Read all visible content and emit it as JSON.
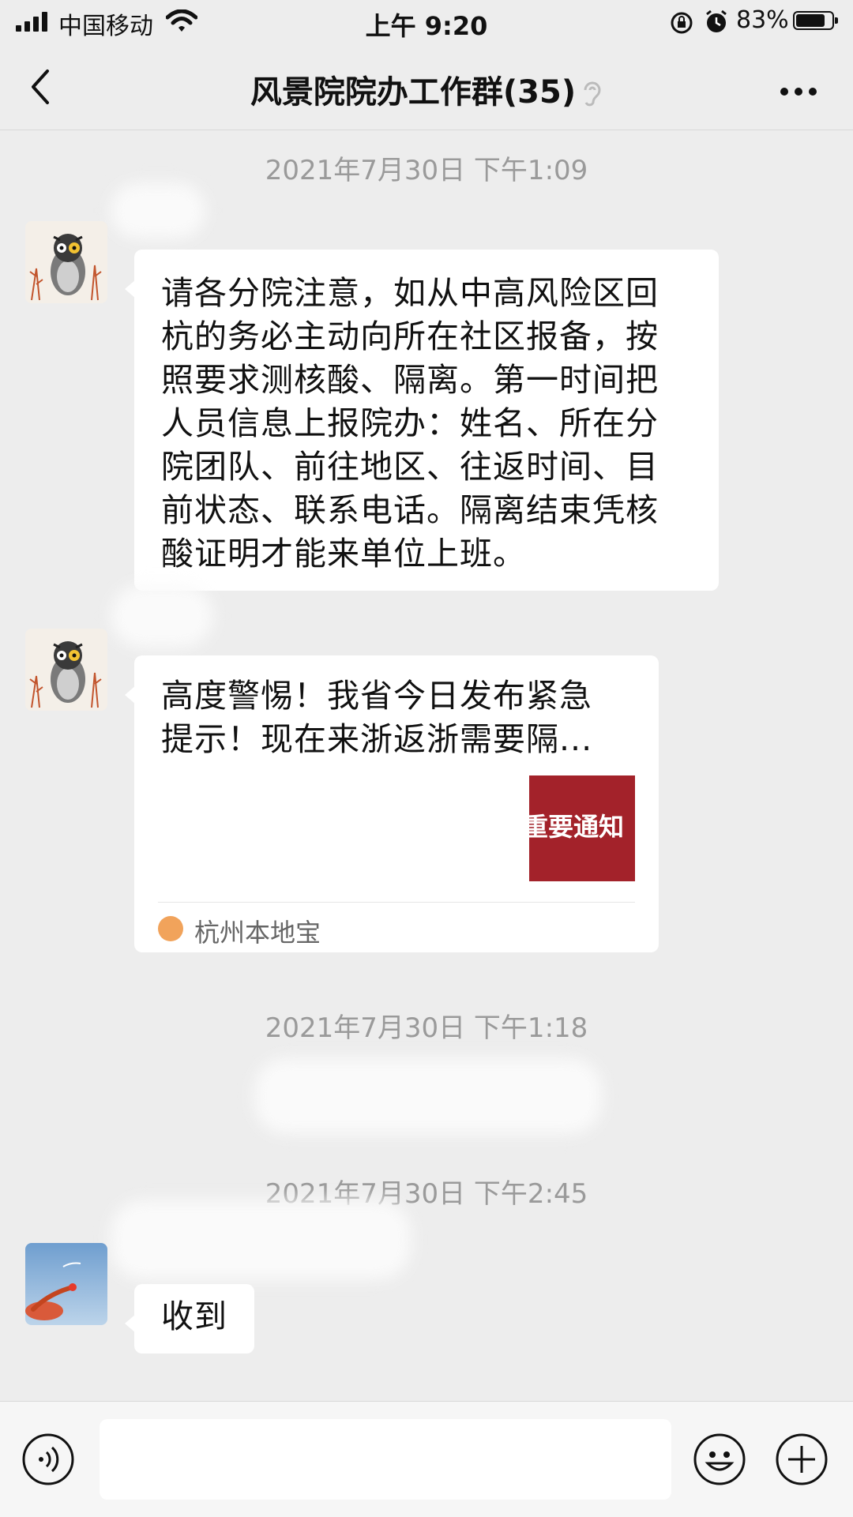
{
  "status_bar": {
    "carrier": "中国移动",
    "time": "上午 9:20",
    "battery": "83%",
    "battery_level": 0.83
  },
  "header": {
    "title": "风景院院办工作群(35)"
  },
  "messages": [
    {
      "timestamp": "2021年7月30日 下午1:09",
      "text": "请各分院注意，如从中高风险区回\n杭的务必主动向所在社区报备，按\n照要求测核酸、隔离。第一时间把\n人员信息上报院办：姓名、所在分\n院团队、前往地区、往返时间、目\n前状态、联系电话。隔离结束凭核\n酸证明才能来单位上班。"
    },
    {
      "link_title": "高度警惕！我省今日发布紧急\n提示！现在来浙返浙需要隔...",
      "thumb_text": "重要通知",
      "source": "杭州本地宝"
    },
    {
      "timestamp": "2021年7月30日 下午1:18"
    },
    {
      "timestamp": "2021年7月30日 下午2:45",
      "text": "收到"
    }
  ],
  "icons": {
    "back": "chevron-left-icon",
    "more": "more-icon",
    "voice": "voice-icon",
    "emoji": "emoji-icon",
    "plus": "plus-icon",
    "mute": "mute-icon"
  }
}
